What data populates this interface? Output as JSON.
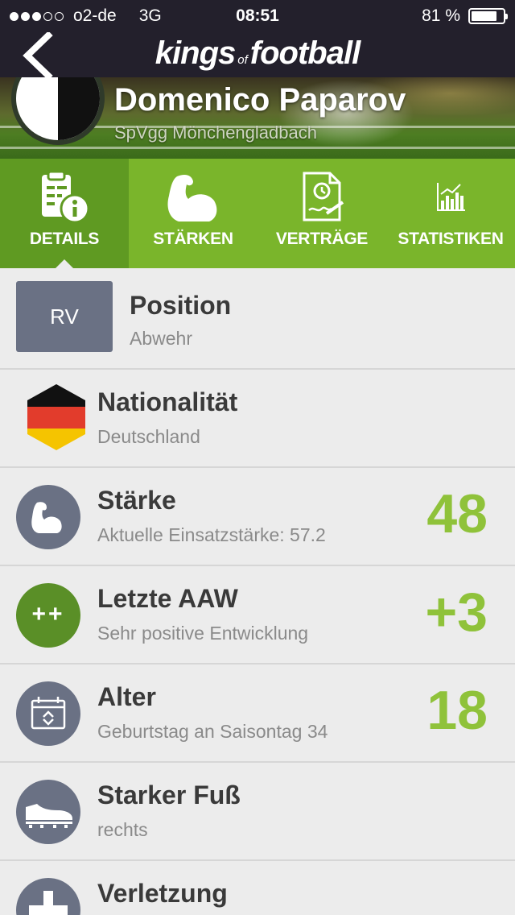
{
  "status_bar": {
    "carrier": "o2-de",
    "network": "3G",
    "time": "08:51",
    "battery": "81 %",
    "battery_level": 0.81
  },
  "header": {
    "logo_main_1": "kings",
    "logo_of": "of",
    "logo_main_2": "football"
  },
  "player": {
    "name": "Domenico Paparov",
    "club": "SpVgg Mönchengladbach"
  },
  "tabs": [
    {
      "label": "DETAILS",
      "icon": "details-icon",
      "active": true
    },
    {
      "label": "STÄRKEN",
      "icon": "muscle-icon",
      "active": false
    },
    {
      "label": "VERTRÄGE",
      "icon": "contract-icon",
      "active": false
    },
    {
      "label": "STATISTIKEN",
      "icon": "stats-icon",
      "active": false
    }
  ],
  "rows": {
    "position": {
      "badge": "RV",
      "title": "Position",
      "sub": "Abwehr"
    },
    "nationality": {
      "title": "Nationalität",
      "sub": "Deutschland"
    },
    "strength": {
      "title": "Stärke",
      "sub": "Aktuelle Einsatzstärke: 57.2",
      "value": "48"
    },
    "aaw": {
      "badge": "++",
      "title": "Letzte AAW",
      "sub": "Sehr positive Entwicklung",
      "value": "+3"
    },
    "age": {
      "title": "Alter",
      "sub": "Geburtstag an Saisontag 34",
      "value": "18"
    },
    "foot": {
      "title": "Starker Fuß",
      "sub": "rechts"
    },
    "injury": {
      "title": "Verletzung"
    }
  },
  "colors": {
    "accent_green": "#8fc23a",
    "tab_green": "#7ab52b",
    "tab_active": "#5f9a22",
    "icon_grey": "#6a7184",
    "header_dark": "#23202c"
  }
}
